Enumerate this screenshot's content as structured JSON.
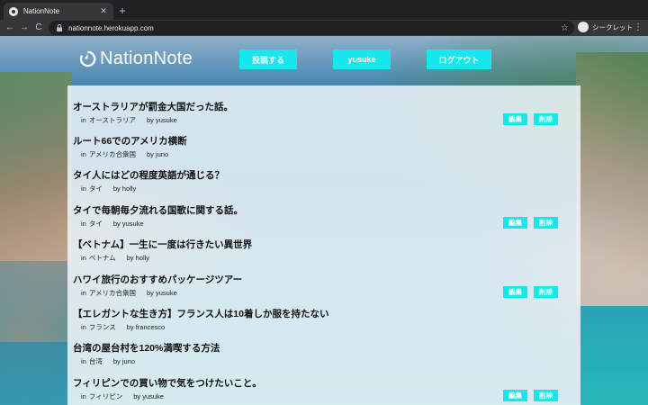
{
  "browser": {
    "tab_title": "NationNote",
    "tab_close": "✕",
    "new_tab": "+",
    "back": "←",
    "forward": "→",
    "reload": "C",
    "url": "nationnote.herokuapp.com",
    "star": "☆",
    "incognito_label": "シークレット",
    "menu": "⋮"
  },
  "header": {
    "logo_text": "NationNote",
    "post_button": "投稿する",
    "user_button": "yusuke",
    "logout_button": "ログアウト"
  },
  "articles": [
    {
      "title": "オーストラリアが罰金大国だった話。",
      "country_prefix": "in",
      "country": "オーストラリア",
      "author": "by yusuke",
      "editable": true
    },
    {
      "title": "ルート66でのアメリカ横断",
      "country_prefix": "in",
      "country": "アメリカ合衆国",
      "author": "by juno",
      "editable": false
    },
    {
      "title": "タイ人にはどの程度英語が通じる？",
      "country_prefix": "in",
      "country": "タイ",
      "author": "by holly",
      "editable": false
    },
    {
      "title": "タイで毎朝毎夕流れる国歌に関する話。",
      "country_prefix": "in",
      "country": "タイ",
      "author": "by yusuke",
      "editable": true
    },
    {
      "title": "【ベトナム】一生に一度は行きたい異世界",
      "country_prefix": "in",
      "country": "ベトナム",
      "author": "by holly",
      "editable": false
    },
    {
      "title": "ハワイ旅行のおすすめパッケージツアー",
      "country_prefix": "in",
      "country": "アメリカ合衆国",
      "author": "by yusuke",
      "editable": true
    },
    {
      "title": "【エレガントな生き方】フランス人は10着しか服を持たない",
      "country_prefix": "in",
      "country": "フランス",
      "author": "by francesco",
      "editable": false
    },
    {
      "title": "台湾の屋台村を120%満喫する方法",
      "country_prefix": "in",
      "country": "台湾",
      "author": "by juno",
      "editable": false
    },
    {
      "title": "フィリピンでの買い物で気をつけたいこと。",
      "country_prefix": "in",
      "country": "フィリピン",
      "author": "by yusuke",
      "editable": true
    }
  ],
  "actions": {
    "edit_label": "編集",
    "delete_label": "削除"
  },
  "colors": {
    "accent": "#17e6ec",
    "chrome_dark": "#202124",
    "chrome_toolbar": "#35363a"
  }
}
